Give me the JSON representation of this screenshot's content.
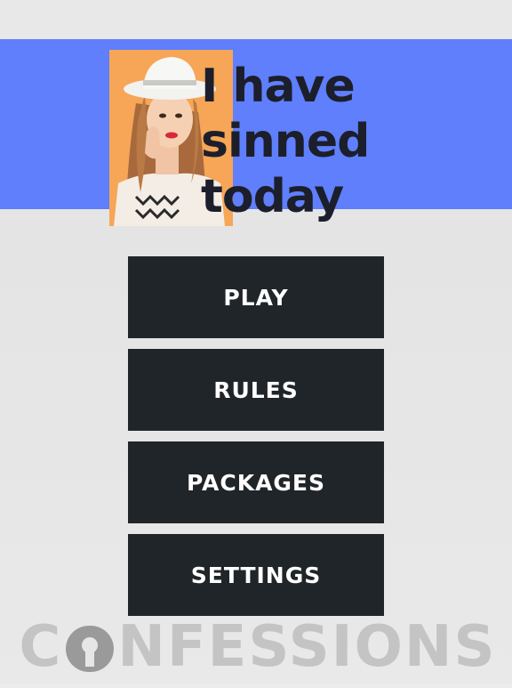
{
  "title": {
    "line1": "I have",
    "line2": "sinned",
    "line3": "today"
  },
  "menu": {
    "play": "PLAY",
    "rules": "RULES",
    "packages": "PACKAGES",
    "settings": "SETTINGS"
  },
  "logo": {
    "prefix": "C",
    "suffix": "NFESSIONS"
  },
  "colors": {
    "banner": "#5f7ffc",
    "button": "#1f2528",
    "title_text": "#1c1f2b",
    "photo_bg": "#f6a656",
    "logo_text": "#c4c4c4",
    "logo_lock": "#9a9a9a"
  }
}
